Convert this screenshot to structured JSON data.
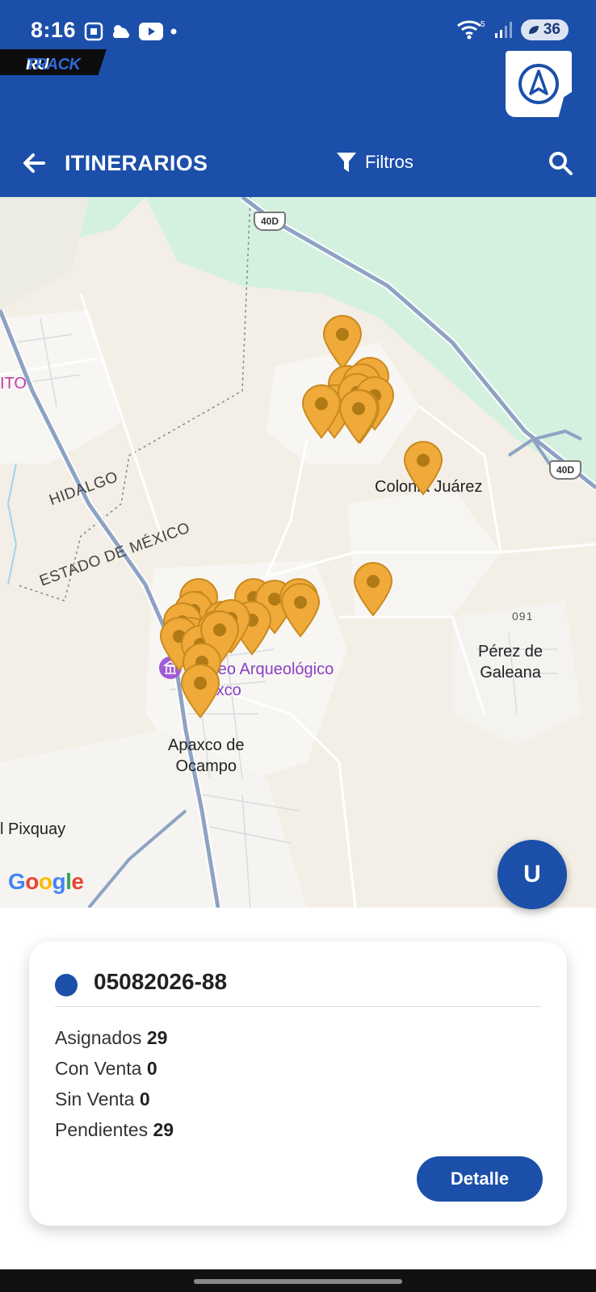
{
  "status_bar": {
    "time": "8:16",
    "battery_level": "36",
    "wifi_badge": "5",
    "left_icons": [
      "screenshot-icon",
      "weather-icon",
      "youtube-icon",
      "dot-icon"
    ]
  },
  "brand": {
    "ru": "RU",
    "track": "TRACK"
  },
  "header": {
    "title": "ITINERARIOS",
    "filter_label": "Filtros"
  },
  "map": {
    "labels": {
      "colonia_juarez": "Colonia Juárez",
      "hidalgo": "HIDALGO",
      "estado_mexico": "ESTADO DE MÉXICO",
      "museo_line1": "Museo Arqueológico",
      "museo_line2": "Apaxco",
      "apaxco_line1": "Apaxco de",
      "apaxco_line2": "Ocampo",
      "perez_line1": "Pérez de",
      "perez_line2": "Galeana",
      "pixquay": "l Pixquay",
      "road_091": "091",
      "ito": "ITO",
      "s_suffix": "s",
      "highway_top": "40D",
      "highway_right": "40D"
    },
    "google_logo": "Google",
    "marker_color": "#efaa3a",
    "avatar_initial": "U"
  },
  "card": {
    "code": "05082026-88",
    "stats": [
      {
        "label": "Asignados",
        "value": "29"
      },
      {
        "label": "Con Venta",
        "value": "0"
      },
      {
        "label": "Sin Venta",
        "value": "0"
      },
      {
        "label": "Pendientes",
        "value": "29"
      }
    ],
    "detail_button": "Detalle"
  },
  "colors": {
    "primary": "#1b4faa",
    "marker": "#efaa3a",
    "map_green": "#d4f1df"
  }
}
